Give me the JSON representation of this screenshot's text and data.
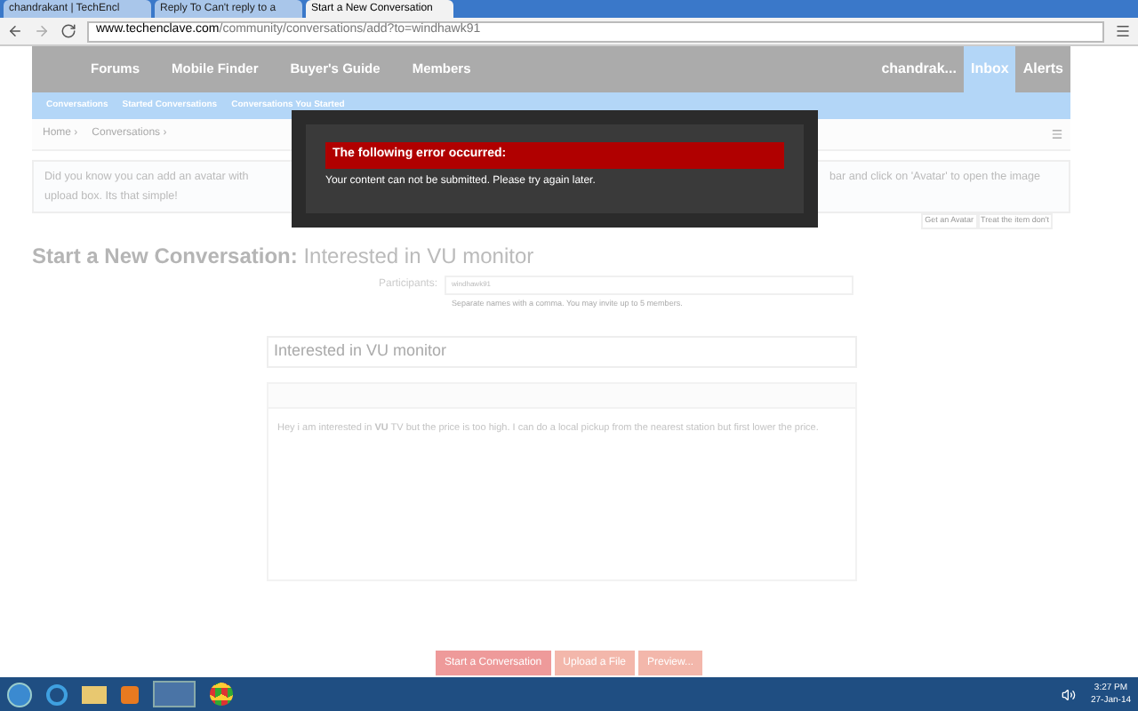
{
  "browser": {
    "tabs": [
      {
        "label": "chandrakant | TechEncl",
        "selected": false
      },
      {
        "label": "Reply To Can't reply to a",
        "selected": false
      },
      {
        "label": "Start a New Conversation",
        "selected": true
      }
    ],
    "url_host": "www.techenclave.com",
    "url_path": "/community/conversations/add?to=windhawk91"
  },
  "nav": {
    "items": [
      {
        "label": "Forums",
        "selected": false
      },
      {
        "label": "Mobile Finder",
        "selected": false
      },
      {
        "label": "Buyer's Guide",
        "selected": false
      },
      {
        "label": "Members",
        "selected": false
      }
    ],
    "user": [
      {
        "label": "chandrak...",
        "selected": false
      },
      {
        "label": "Inbox",
        "selected": true
      },
      {
        "label": "Alerts",
        "selected": false
      }
    ]
  },
  "subnav": [
    "Conversations",
    "Started Conversations",
    "Conversations You Started"
  ],
  "breadcrumb": [
    "Home ›",
    "Conversations ›"
  ],
  "notice": {
    "left": "Did you know you can add an avatar with",
    "right": "bar and click on 'Avatar' to open the image",
    "line2": "upload box. Its that simple!",
    "links": [
      "Get an Avatar",
      "Treat the item don't"
    ]
  },
  "heading": {
    "prefix": "Start a New Conversation:",
    "title": "Interested in VU monitor"
  },
  "participants": {
    "label": "Participants:",
    "value": "windhawk91",
    "hint": "Separate names with a comma. You may invite up to 5 members."
  },
  "subject": "Interested in VU monitor",
  "message": "Hey i am interested in **VU** TV but the price is too high. I can do a local pickup from the nearest station but first lower the price.",
  "buttons": [
    {
      "label": "Start a Conversation",
      "kind": "primary"
    },
    {
      "label": "Upload a File",
      "kind": "secondary"
    },
    {
      "label": "Preview...",
      "kind": "secondary"
    }
  ],
  "dialog": {
    "title": "The following error occurred:",
    "message": "Your content can not be submitted. Please try again later."
  },
  "taskbar": {
    "time": "3:27 PM",
    "date": "27-Jan-14"
  }
}
